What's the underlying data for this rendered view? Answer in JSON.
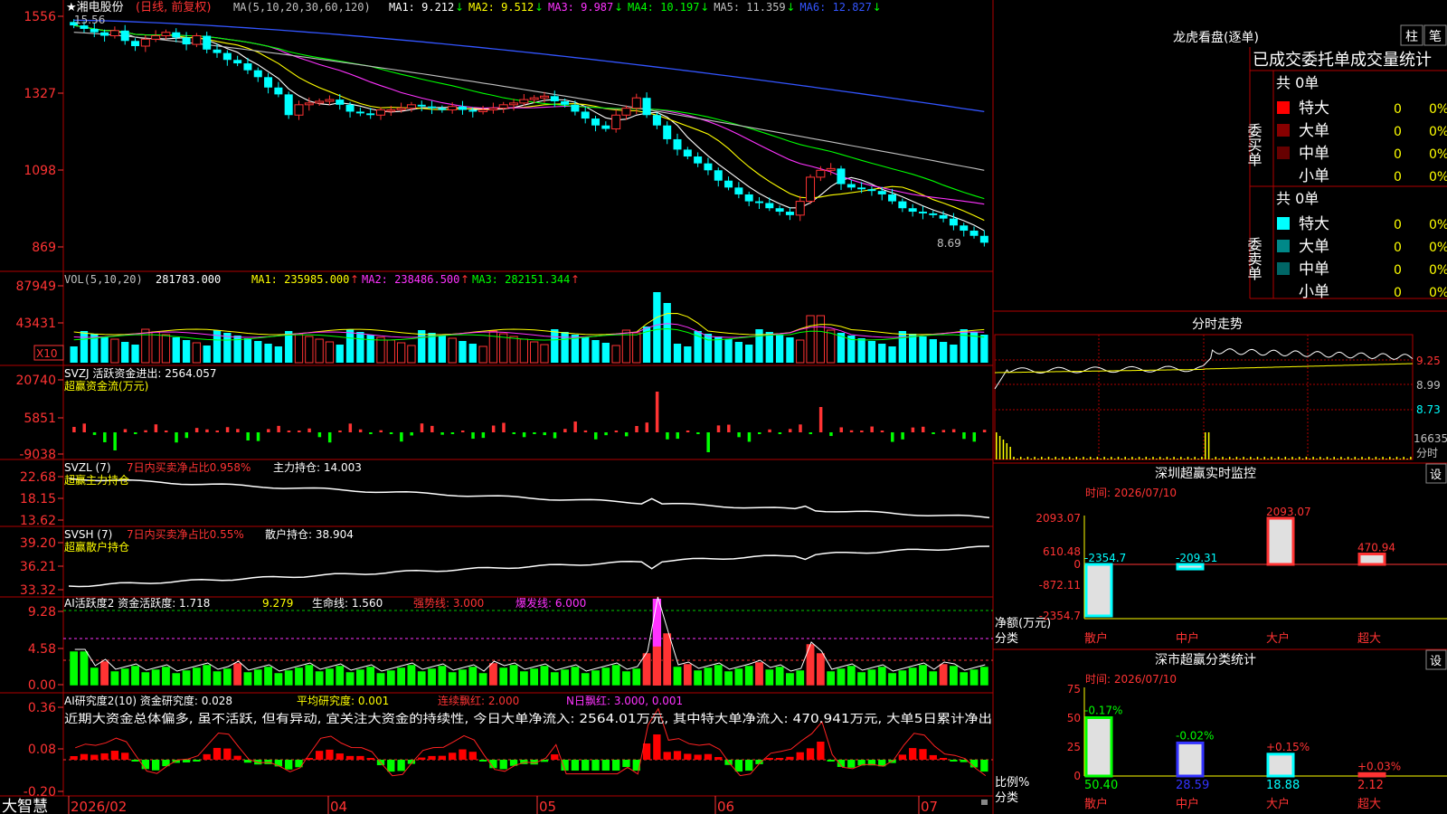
{
  "stock": {
    "title": "★湘电股份",
    "period": "(日线, 前复权)",
    "ma_label": "MA(5,10,20,30,60,120)",
    "ma_values": [
      {
        "label": "MA1: 9.212",
        "arrow": "↓",
        "color": "#ffffff"
      },
      {
        "label": "MA2: 9.512",
        "arrow": "↓",
        "color": "#ffff00"
      },
      {
        "label": "MA3: 9.987",
        "arrow": "↓",
        "color": "#ff33ff"
      },
      {
        "label": "MA4: 10.197",
        "arrow": "↓",
        "color": "#00ff00"
      },
      {
        "label": "MA5: 11.359",
        "arrow": "↓",
        "color": "#c0c0c0"
      },
      {
        "label": "MA6: 12.827",
        "arrow": "↓",
        "color": "#3355ff"
      }
    ],
    "high_mark": "15.56",
    "low_mark": "8.69",
    "y_ticks": [
      "1556",
      "1327",
      "1098",
      "869"
    ],
    "closes": [
      15.4,
      15.3,
      15.2,
      15.1,
      15.25,
      14.95,
      14.8,
      15.0,
      15.1,
      15.2,
      15.05,
      14.85,
      15.1,
      14.7,
      14.6,
      14.4,
      14.3,
      14.1,
      13.9,
      13.6,
      13.4,
      12.8,
      13.1,
      13.15,
      13.2,
      13.25,
      13.1,
      12.9,
      12.85,
      12.8,
      12.95,
      12.95,
      13.0,
      13.1,
      13.05,
      13.0,
      12.95,
      13.05,
      12.95,
      12.9,
      12.95,
      13.0,
      13.1,
      13.15,
      13.25,
      13.3,
      13.35,
      13.2,
      13.1,
      12.9,
      12.7,
      12.5,
      12.4,
      12.8,
      13.0,
      13.3,
      12.8,
      12.5,
      12.1,
      11.8,
      11.6,
      11.4,
      11.2,
      10.9,
      10.7,
      10.5,
      10.3,
      10.25,
      10.1,
      10.0,
      9.9,
      10.3,
      11.0,
      11.2,
      11.25,
      10.8,
      10.7,
      10.65,
      10.6,
      10.5,
      10.3,
      10.1,
      10.0,
      9.95,
      9.9,
      9.8,
      9.6,
      9.45,
      9.3,
      9.1
    ]
  },
  "volume": {
    "label": "VOL(5,10,20)",
    "value": "281783.000",
    "mas": [
      {
        "label": "MA1: 235985.000",
        "color": "#ffff00"
      },
      {
        "label": "MA2: 238486.500",
        "color": "#ff33ff"
      },
      {
        "label": "MA3: 282151.344",
        "color": "#00ff00"
      }
    ],
    "y_ticks": [
      "87949",
      "43431"
    ],
    "unit": "X10"
  },
  "svzj": {
    "label": "SVZJ  活跃资金进出: 2564.057",
    "subtitle": "超赢资金流(万元)",
    "y_ticks": [
      "20740",
      "5851",
      "-9038"
    ]
  },
  "svzl": {
    "label_pre": "SVZL (7) ",
    "label_red": "7日内买卖净占比0.958%",
    "label_post": " 主力持仓: 14.003",
    "subtitle": "超赢主力持仓",
    "y_ticks": [
      "22.68",
      "18.15",
      "13.62"
    ]
  },
  "svsh": {
    "label_pre": "SVSH (7) ",
    "label_red": "7日内买卖净占比0.55%",
    "label_post": " 散户持仓: 38.904",
    "subtitle": "超赢散户持仓",
    "y_ticks": [
      "39.20",
      "36.21",
      "33.32"
    ]
  },
  "ai_active": {
    "label": "AI活跃度2 资金活跃度: 1.718",
    "v2": "9.279",
    "life": "生命线: 1.560",
    "strong": "强势线: 3.000",
    "burst": "爆发线: 6.000",
    "y_ticks": [
      "9.28",
      "4.58",
      "0.00"
    ]
  },
  "ai_research": {
    "label": "AI研究度2(10) 资金研究度: 0.028",
    "avg": "平均研究度: 0.001",
    "consec": "连续飘红: 2.000",
    "nday": "N日飘红: 3.000, 0.001",
    "comment": "近期大资金总体偏多, 虽不活跃, 但有异动, 宜关注大资金的持续性, 今日大单净流入: 2564.01万元, 其中特大单净流入: 470.941万元, 大单5日累计净出",
    "y_ticks": [
      "0.36",
      "0.08",
      "-0.20"
    ]
  },
  "bottom": {
    "brand": "大智慧",
    "dates": [
      "2026/02",
      "04",
      "05",
      "06",
      "07"
    ]
  },
  "longhu": {
    "title": "龙虎看盘(逐单)",
    "btn1": "柱",
    "btn2": "笔",
    "header": "已成交委托单成交量统计",
    "buy_label": "委买单",
    "sell_label": "委卖单",
    "total": "共 0单",
    "rows": [
      "特大",
      "大单",
      "中单",
      "小单"
    ],
    "buy_colors": [
      "#ff0000",
      "#880000",
      "#660000",
      "#000000"
    ],
    "sell_colors": [
      "#00ffff",
      "#008888",
      "#006666",
      "#000000"
    ],
    "zero": "0",
    "pct": "0%"
  },
  "intraday": {
    "title": "分时走势",
    "y_ticks": [
      "9.25",
      "8.99",
      "8.73"
    ],
    "vol_top": "16635",
    "vol_unit": "分时"
  },
  "sz_monitor": {
    "title": "深圳超赢实时监控",
    "btn": "设",
    "time": "时间: 2026/07/10",
    "y_ticks": [
      "2093.07",
      "610.48",
      "0",
      "-872.11",
      "-2354.7"
    ],
    "bars": [
      {
        "cat": "散户",
        "value": -2354.7,
        "label": "-2354.7"
      },
      {
        "cat": "中户",
        "value": -209.31,
        "label": "-209.31"
      },
      {
        "cat": "大户",
        "value": 2093.07,
        "label": "2093.07"
      },
      {
        "cat": "超大",
        "value": 470.94,
        "label": "470.94"
      }
    ],
    "ylabel1": "净额(万元)",
    "ylabel2": "分类"
  },
  "sz_class": {
    "title": "深市超赢分类统计",
    "btn": "设",
    "time": "时间: 2026/07/10",
    "y_ticks": [
      "75",
      "50",
      "25",
      "0"
    ],
    "bars": [
      {
        "cat": "散户",
        "value": 50.4,
        "top": "-0.17%",
        "bottom": "50.40"
      },
      {
        "cat": "中户",
        "value": 28.59,
        "top": "-0.02%",
        "bottom": "28.59"
      },
      {
        "cat": "大户",
        "value": 18.88,
        "top": "+0.15%",
        "bottom": "18.88"
      },
      {
        "cat": "超大",
        "value": 2.12,
        "top": "+0.03%",
        "bottom": "2.12"
      }
    ],
    "ylabel1": "比例%",
    "ylabel2": "分类"
  },
  "chart_data": [
    {
      "type": "line",
      "title": "湘电股份 (日线, 前复权) closing price",
      "x_range": [
        "2026/02",
        "2026/07/10"
      ],
      "values": [
        15.4,
        15.3,
        15.2,
        15.1,
        15.25,
        14.95,
        14.8,
        15.0,
        15.1,
        15.2,
        15.05,
        14.85,
        15.1,
        14.7,
        14.6,
        14.4,
        14.3,
        14.1,
        13.9,
        13.6,
        13.4,
        12.8,
        13.1,
        13.15,
        13.2,
        13.25,
        13.1,
        12.9,
        12.85,
        12.8,
        12.95,
        12.95,
        13.0,
        13.1,
        13.05,
        13.0,
        12.95,
        13.05,
        12.95,
        12.9,
        12.95,
        13.0,
        13.1,
        13.15,
        13.25,
        13.3,
        13.35,
        13.2,
        13.1,
        12.9,
        12.7,
        12.5,
        12.4,
        12.8,
        13.0,
        13.3,
        12.8,
        12.5,
        12.1,
        11.8,
        11.6,
        11.4,
        11.2,
        10.9,
        10.7,
        10.5,
        10.3,
        10.25,
        10.1,
        10.0,
        9.9,
        10.3,
        11.0,
        11.2,
        11.25,
        10.8,
        10.7,
        10.65,
        10.6,
        10.5,
        10.3,
        10.1,
        10.0,
        9.95,
        9.9,
        9.8,
        9.6,
        9.45,
        9.3,
        9.1
      ],
      "ylim": [
        8.69,
        15.56
      ]
    },
    {
      "type": "bar",
      "title": "深圳超赢实时监控",
      "categories": [
        "散户",
        "中户",
        "大户",
        "超大"
      ],
      "values": [
        -2354.7,
        -209.31,
        2093.07,
        470.94
      ],
      "ylabel": "净额(万元)",
      "ylim": [
        -2354.7,
        2093.07
      ]
    },
    {
      "type": "bar",
      "title": "深市超赢分类统计",
      "categories": [
        "散户",
        "中户",
        "大户",
        "超大"
      ],
      "values": [
        50.4,
        28.59,
        18.88,
        2.12
      ],
      "ylabel": "比例%",
      "ylim": [
        0,
        75
      ]
    }
  ]
}
